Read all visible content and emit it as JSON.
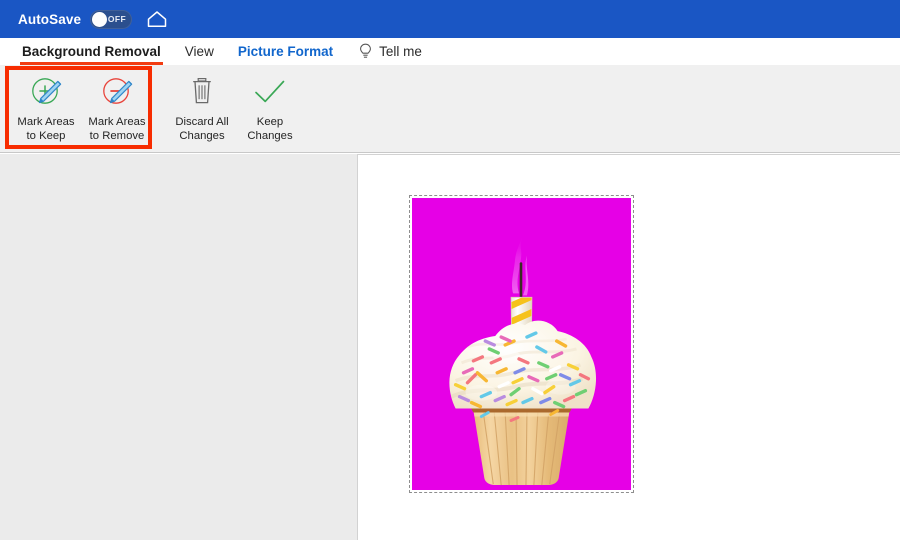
{
  "titlebar": {
    "autosave_label": "AutoSave",
    "toggle_state": "OFF",
    "home_icon": "home-icon",
    "background_color": "#1a56c4"
  },
  "tabs": [
    {
      "label": "Background Removal",
      "state": "active",
      "icon": null
    },
    {
      "label": "View",
      "state": "normal",
      "icon": null
    },
    {
      "label": "Picture Format",
      "state": "accent",
      "icon": null
    },
    {
      "label": "Tell me",
      "state": "normal",
      "icon": "lightbulb-icon"
    }
  ],
  "ribbon": {
    "highlight_color": "#f72c00",
    "buttons": [
      {
        "label": "Mark Areas\nto Keep",
        "icon": "mark-keep-icon",
        "highlighted": true
      },
      {
        "label": "Mark Areas\nto Remove",
        "icon": "mark-remove-icon",
        "highlighted": true
      },
      {
        "label": "Discard All\nChanges",
        "icon": "trash-icon",
        "highlighted": false
      },
      {
        "label": "Keep\nChanges",
        "icon": "checkmark-icon",
        "highlighted": false
      }
    ]
  },
  "canvas": {
    "workspace_color": "#ebebeb",
    "document_color": "#ffffff",
    "picture": {
      "alt": "Cupcake with white frosting, rainbow sprinkles and a yellow striped birthday candle on a magenta background",
      "background_color": "#e600e6",
      "selected": true,
      "frosting_color": "#fdf7e8",
      "cake_color": "#c98a44",
      "liner_color": "#f0c98a",
      "candle_stripe_color": "#f5c518"
    }
  },
  "colors": {
    "accent_blue": "#1166cc",
    "tab_underline": "#f23c12",
    "title_blue": "#1a56c4",
    "check_green": "#2fa84f",
    "keep_green": "#38a05a",
    "remove_red": "#e8453c",
    "pencil_blue": "#3f9fe0"
  }
}
